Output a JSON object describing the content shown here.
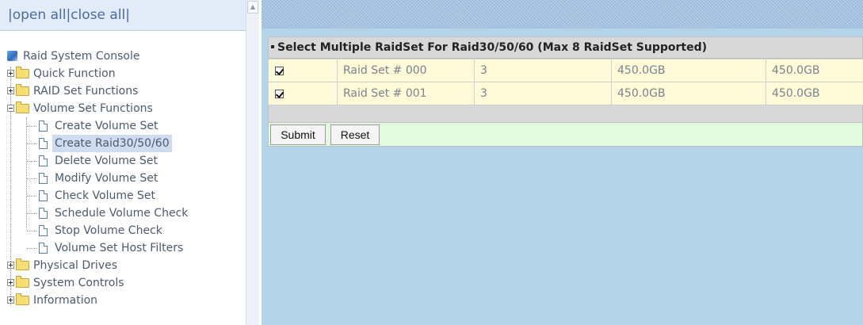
{
  "left_frame": {
    "open_all": "open all",
    "close_all": "close all",
    "separator": "|",
    "tree": {
      "root_label": "Raid System Console",
      "items": [
        {
          "label": "Quick Function",
          "expanded": false
        },
        {
          "label": "RAID Set Functions",
          "expanded": false
        },
        {
          "label": "Volume Set Functions",
          "expanded": true,
          "children": [
            "Create Volume Set",
            "Create Raid30/50/60",
            "Delete Volume Set",
            "Modify Volume Set",
            "Check Volume Set",
            "Schedule Volume Check",
            "Stop Volume Check",
            "Volume Set Host Filters"
          ],
          "selected_child": "Create Raid30/50/60"
        },
        {
          "label": "Physical Drives",
          "expanded": false
        },
        {
          "label": "System Controls",
          "expanded": false
        },
        {
          "label": "Information",
          "expanded": false
        }
      ]
    }
  },
  "main": {
    "panel_title": "Select Multiple RaidSet For Raid30/50/60 (Max 8 RaidSet Supported)",
    "rows": [
      {
        "checked": true,
        "name": "Raid Set # 000",
        "disks": "3",
        "total": "450.0GB",
        "free": "450.0GB"
      },
      {
        "checked": true,
        "name": "Raid Set # 001",
        "disks": "3",
        "total": "450.0GB",
        "free": "450.0GB"
      }
    ],
    "submit_label": "Submit",
    "reset_label": "Reset"
  },
  "colors": {
    "right_background": "#b4d4e8",
    "row_background": "#fffad8",
    "button_bar_background": "#e4fae0",
    "header_background": "#d8d8d8"
  }
}
